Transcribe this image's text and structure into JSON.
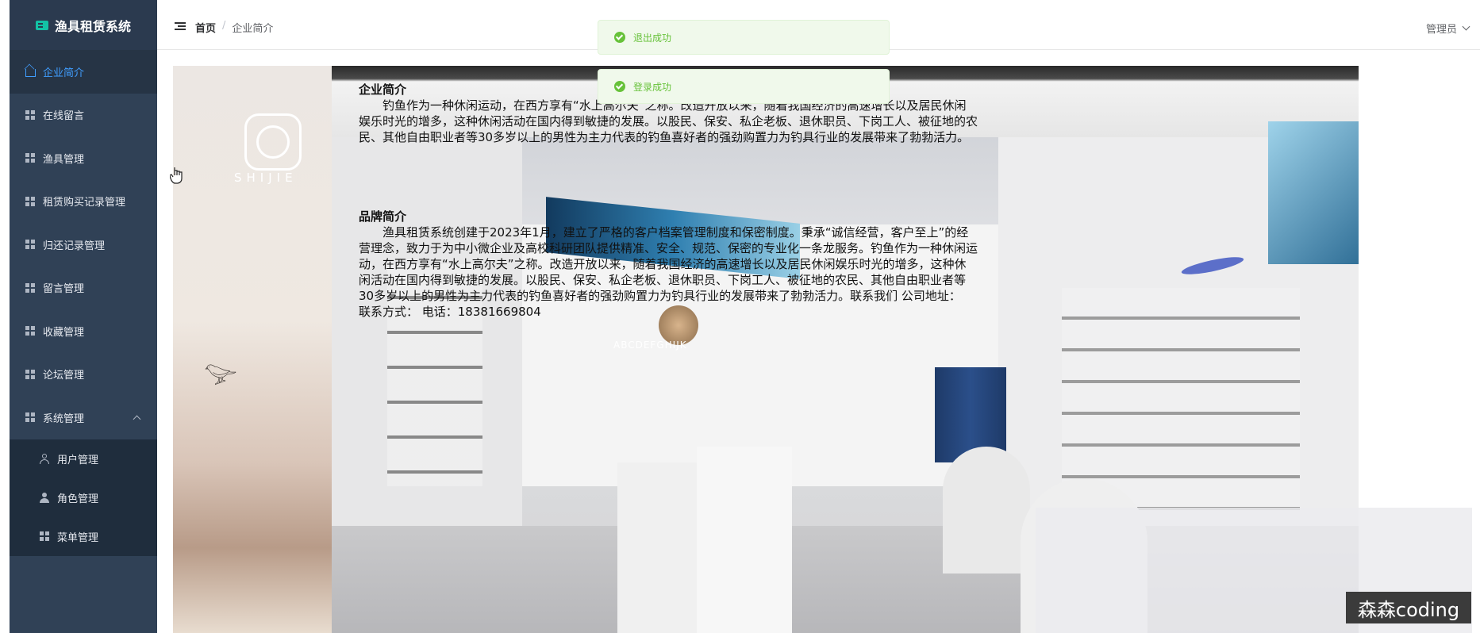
{
  "app": {
    "title": "渔具租赁系统"
  },
  "sidebar": {
    "items": [
      {
        "label": "企业简介",
        "icon": "home-icon",
        "active": true
      },
      {
        "label": "在线留言",
        "icon": "grid-icon"
      },
      {
        "label": "渔具管理",
        "icon": "grid-icon"
      },
      {
        "label": "租赁购买记录管理",
        "icon": "grid-icon"
      },
      {
        "label": "归还记录管理",
        "icon": "grid-icon"
      },
      {
        "label": "留言管理",
        "icon": "grid-icon"
      },
      {
        "label": "收藏管理",
        "icon": "grid-icon"
      },
      {
        "label": "论坛管理",
        "icon": "grid-icon"
      },
      {
        "label": "系统管理",
        "icon": "grid-icon",
        "expanded": true
      }
    ],
    "submenu": [
      {
        "label": "用户管理",
        "icon": "user-icon"
      },
      {
        "label": "角色管理",
        "icon": "role-icon"
      },
      {
        "label": "菜单管理",
        "icon": "grid-icon"
      }
    ]
  },
  "header": {
    "breadcrumb": {
      "home": "首页",
      "separator": "/",
      "current": "企业简介"
    },
    "user": "管理员"
  },
  "toasts": [
    {
      "text": "退出成功",
      "type": "success"
    },
    {
      "text": "登录成功",
      "type": "success"
    }
  ],
  "hero": {
    "logo_text": "SHIJIE",
    "abc_text": "ABCDEFGHIJK"
  },
  "content": {
    "company_title": "企业简介",
    "company_text": "钓鱼作为一种休闲运动，在西方享有“水上高尔夫”之称。改造开放以来，随着我国经济的高速增长以及居民休闲娱乐时光的增多，这种休闲活动在国内得到敏捷的发展。以股民、保安、私企老板、退休职员、下岗工人、被征地的农民、其他自由职业者等30多岁以上的男性为主力代表的钓鱼喜好者的强劲购置力为钓具行业的发展带来了勃勃活力。",
    "brand_title": "品牌简介",
    "brand_text": "渔具租赁系统创建于2023年1月，建立了严格的客户档案管理制度和保密制度。秉承“诚信经营，客户至上”的经营理念，致力于为中小微企业及高校科研团队提供精准、安全、规范、保密的专业化一条龙服务。钓鱼作为一种休闲运动，在西方享有“水上高尔夫”之称。改造开放以来，随着我国经济的高速增长以及居民休闲娱乐时光的增多，这种休闲活动在国内得到敏捷的发展。以股民、保安、私企老板、退休职员、下岗工人、被征地的农民、其他自由职业者等30多岁以上的男性为主力代表的钓鱼喜好者的强劲购置力为钓具行业的发展带来了勃勃活力。联系我们 公司地址：",
    "contact": "联系方式： 电话：18381669804"
  },
  "watermark": "森森coding",
  "colors": {
    "sidebar_bg": "#304156",
    "active": "#409eff",
    "success": "#67c23a"
  }
}
